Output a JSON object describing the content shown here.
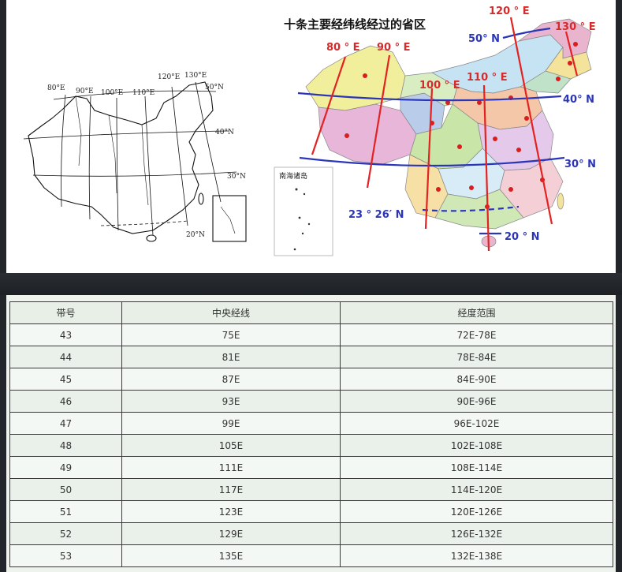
{
  "left_map": {
    "lon_labels": [
      "80°E",
      "90°E",
      "100°E",
      "110°E",
      "120°E",
      "130°E"
    ],
    "lat_labels": [
      "50°N",
      "40°N",
      "30°N",
      "20°N"
    ]
  },
  "right_map": {
    "title": "十条主要经纬线经过的省区",
    "lon_labels": [
      "80 ° E",
      "90 ° E",
      "100 ° E",
      "110 ° E",
      "120 ° E",
      "130 ° E"
    ],
    "lat_labels": [
      "50° N",
      "40° N",
      "30° N",
      "23 ° 26′ N",
      "20 ° N"
    ],
    "inset_label": "南海诸岛",
    "colors": {
      "meridian": "#e32222",
      "parallel": "#2a35b8"
    }
  },
  "table": {
    "headers": [
      "带号",
      "中央经线",
      "经度范围"
    ],
    "rows": [
      [
        "43",
        "75E",
        "72E-78E"
      ],
      [
        "44",
        "81E",
        "78E-84E"
      ],
      [
        "45",
        "87E",
        "84E-90E"
      ],
      [
        "46",
        "93E",
        "90E-96E"
      ],
      [
        "47",
        "99E",
        "96E-102E"
      ],
      [
        "48",
        "105E",
        "102E-108E"
      ],
      [
        "49",
        "111E",
        "108E-114E"
      ],
      [
        "50",
        "117E",
        "114E-120E"
      ],
      [
        "51",
        "123E",
        "120E-126E"
      ],
      [
        "52",
        "129E",
        "126E-132E"
      ],
      [
        "53",
        "135E",
        "132E-138E"
      ]
    ]
  }
}
